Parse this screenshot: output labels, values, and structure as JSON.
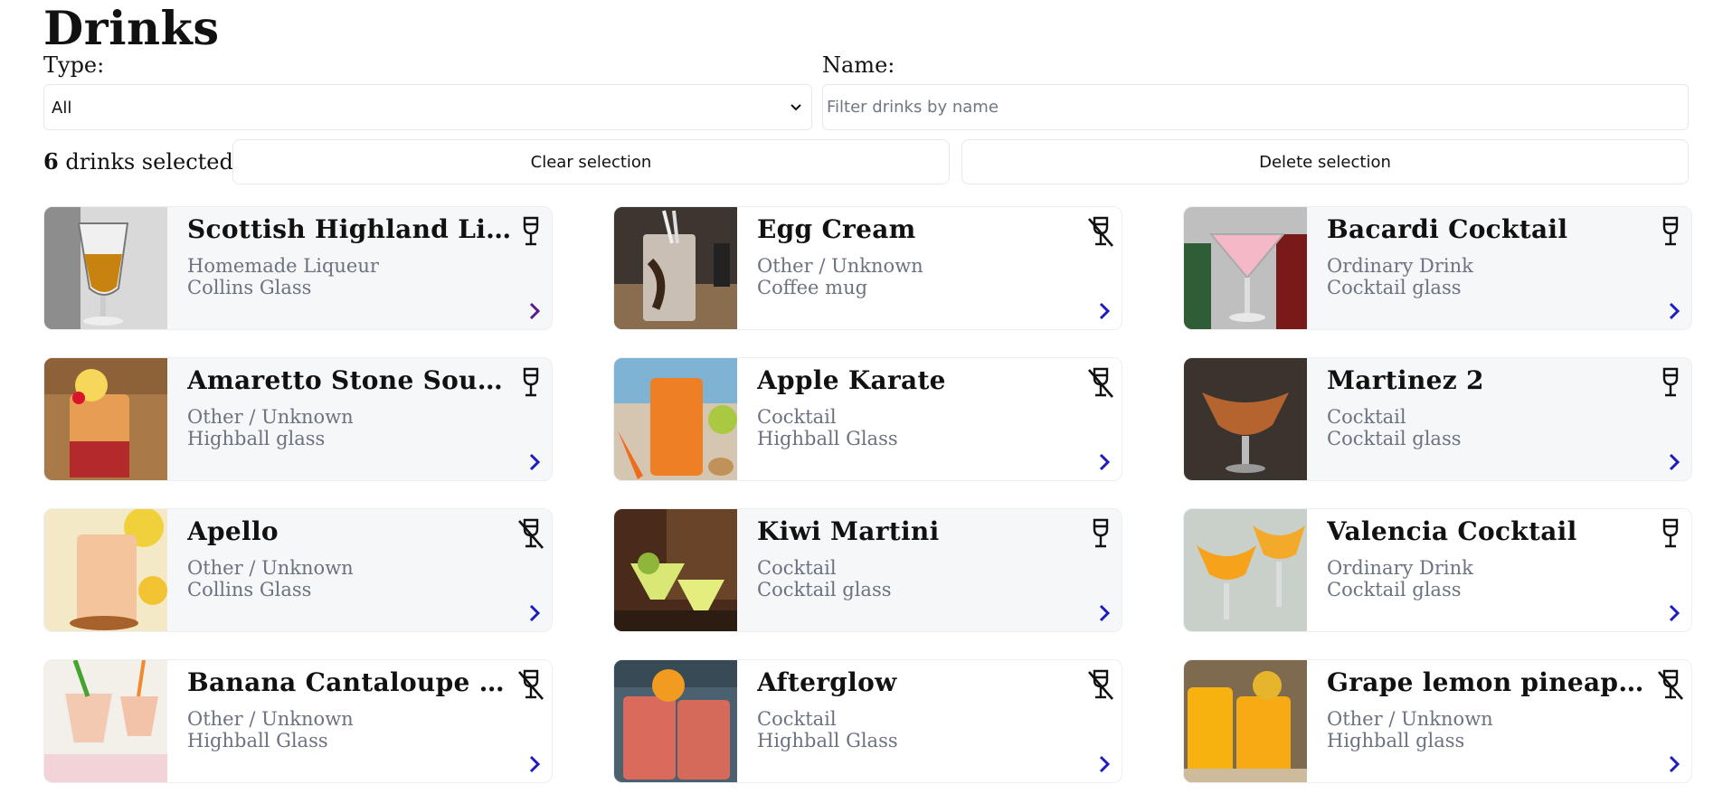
{
  "header": {
    "title": "Drinks"
  },
  "filters": {
    "type_label": "Type:",
    "type_value": "All",
    "name_label": "Name:",
    "name_placeholder": "Filter drinks by name",
    "name_value": ""
  },
  "selection": {
    "count": "6",
    "suffix": "drinks selected",
    "clear_label": "Clear selection",
    "delete_label": "Delete selection"
  },
  "colors": {
    "accent": "#1d1dbf",
    "visited_chevron": "#5b1a8c",
    "muted_text": "#6b7280"
  },
  "drinks": [
    {
      "name": "Scottish Highland Liqueur",
      "category": "Homemade Liqueur",
      "glass": "Collins Glass",
      "alcoholic": true,
      "selected": true,
      "chevron_visited": true
    },
    {
      "name": "Egg Cream",
      "category": "Other / Unknown",
      "glass": "Coffee mug",
      "alcoholic": false,
      "selected": false,
      "chevron_visited": false
    },
    {
      "name": "Bacardi Cocktail",
      "category": "Ordinary Drink",
      "glass": "Cocktail glass",
      "alcoholic": true,
      "selected": true,
      "chevron_visited": false
    },
    {
      "name": "Amaretto Stone Sour Alternative",
      "category": "Other / Unknown",
      "glass": "Highball glass",
      "alcoholic": true,
      "selected": true,
      "chevron_visited": false
    },
    {
      "name": "Apple Karate",
      "category": "Cocktail",
      "glass": "Highball Glass",
      "alcoholic": false,
      "selected": false,
      "chevron_visited": false
    },
    {
      "name": "Martinez 2",
      "category": "Cocktail",
      "glass": "Cocktail glass",
      "alcoholic": true,
      "selected": true,
      "chevron_visited": false
    },
    {
      "name": "Apello",
      "category": "Other / Unknown",
      "glass": "Collins Glass",
      "alcoholic": false,
      "selected": true,
      "chevron_visited": false
    },
    {
      "name": "Kiwi Martini",
      "category": "Cocktail",
      "glass": "Cocktail glass",
      "alcoholic": true,
      "selected": true,
      "chevron_visited": false
    },
    {
      "name": "Valencia Cocktail",
      "category": "Ordinary Drink",
      "glass": "Cocktail glass",
      "alcoholic": true,
      "selected": false,
      "chevron_visited": false
    },
    {
      "name": "Banana Cantaloupe Smoothie",
      "category": "Other / Unknown",
      "glass": "Highball Glass",
      "alcoholic": false,
      "selected": false,
      "chevron_visited": false
    },
    {
      "name": "Afterglow",
      "category": "Cocktail",
      "glass": "Highball Glass",
      "alcoholic": false,
      "selected": false,
      "chevron_visited": false
    },
    {
      "name": "Grape lemon pineapple Smoothie",
      "category": "Other / Unknown",
      "glass": "Highball glass",
      "alcoholic": false,
      "selected": false,
      "chevron_visited": false
    }
  ]
}
